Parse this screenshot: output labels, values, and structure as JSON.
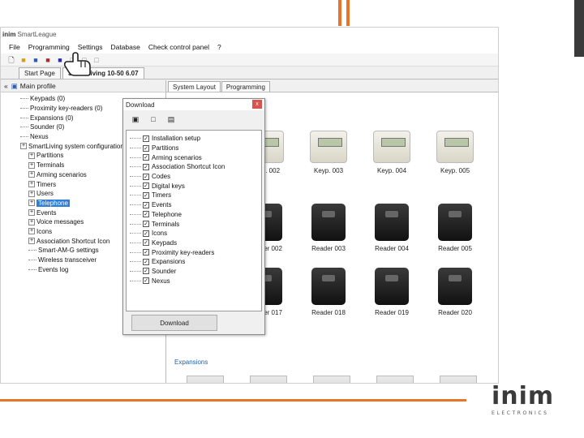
{
  "app": {
    "logo_prefix": "inim",
    "title": "SmartLeague"
  },
  "menu": [
    "File",
    "Programming",
    "Settings",
    "Database",
    "Check control panel",
    "?"
  ],
  "tabs": [
    {
      "label": "Start Page"
    },
    {
      "label": "SmartLiving 10-50 6.07"
    }
  ],
  "left_panel": {
    "header": "Main profile",
    "tree": [
      {
        "label": "Keypads (0)",
        "expand": false
      },
      {
        "label": "Proximity key-readers (0)",
        "expand": false
      },
      {
        "label": "Expansions (0)",
        "expand": false
      },
      {
        "label": "Sounder (0)",
        "expand": false
      },
      {
        "label": "Nexus",
        "expand": false
      },
      {
        "label": "SmartLiving system configuration",
        "expand": true
      },
      {
        "label": "Partitions",
        "expand": true
      },
      {
        "label": "Terminals",
        "expand": true
      },
      {
        "label": "Arming scenarios",
        "expand": true
      },
      {
        "label": "Timers",
        "expand": true
      },
      {
        "label": "Users",
        "expand": true
      },
      {
        "label": "Telephone",
        "expand": true,
        "selected": true
      },
      {
        "label": "Events",
        "expand": true
      },
      {
        "label": "Voice messages",
        "expand": true
      },
      {
        "label": "Icons",
        "expand": true
      },
      {
        "label": "Association Shortcut Icon",
        "expand": true
      },
      {
        "label": "Smart-AM-G settings",
        "expand": false
      },
      {
        "label": "Wireless transceiver",
        "expand": false
      },
      {
        "label": "Events log",
        "expand": false
      }
    ]
  },
  "right_panel": {
    "tabs": [
      "System Layout",
      "Programming"
    ],
    "section_label": "Expansions",
    "keypads": [
      "Keyp. 002",
      "Keyp. 003",
      "Keyp. 004",
      "Keyp. 005"
    ],
    "readers_row1": [
      "Reader 002",
      "Reader 003",
      "Reader 004",
      "Reader 005"
    ],
    "readers_row2": [
      "Reader 017",
      "Reader 018",
      "Reader 019",
      "Reader 020"
    ]
  },
  "dialog": {
    "title": "Download",
    "close": "x",
    "button": "Download",
    "items": [
      "Installation setup",
      "Partitions",
      "Arming scenarios",
      "Association Shortcut Icon",
      "Codes",
      "Digital keys",
      "Timers",
      "Events",
      "Telephone",
      "Terminals",
      "Icons",
      "Keypads",
      "Proximity key-readers",
      "Expansions",
      "Sounder",
      "Nexus"
    ]
  },
  "brand": {
    "name": "inim",
    "tagline": "ELECTRONICS",
    "accent_color": "#e8742a"
  }
}
